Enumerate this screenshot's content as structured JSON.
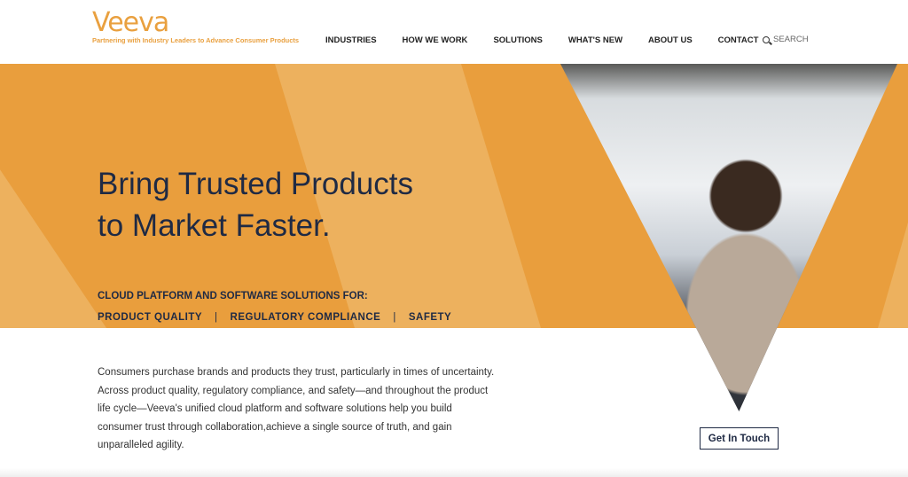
{
  "header": {
    "logo": "Veeva",
    "tagline": "Partnering with Industry Leaders to Advance Consumer Products",
    "nav": [
      "INDUSTRIES",
      "HOW WE WORK",
      "SOLUTIONS",
      "WHAT'S NEW",
      "ABOUT US",
      "CONTACT"
    ],
    "search_label": "SEARCH"
  },
  "hero": {
    "title_line1": "Bring Trusted Products",
    "title_line2": "to Market Faster.",
    "subtitle": "CLOUD PLATFORM AND SOFTWARE SOLUTIONS FOR:",
    "categories": [
      "PRODUCT QUALITY",
      "REGULATORY COMPLIANCE",
      "SAFETY"
    ],
    "separator": "|",
    "colors": {
      "orange": "#E99E3D",
      "light_orange": "#EDB15E",
      "navy": "#1f2a44"
    }
  },
  "main": {
    "body": "Consumers purchase brands and products they trust, particularly in times of uncertainty. Across product quality, regulatory compliance, and safety—and throughout the product life cycle—Veeva's unified cloud platform and software solutions help you build consumer trust through collaboration,achieve a single source of truth, and gain unparalleled agility.",
    "cta": "Get In Touch"
  }
}
